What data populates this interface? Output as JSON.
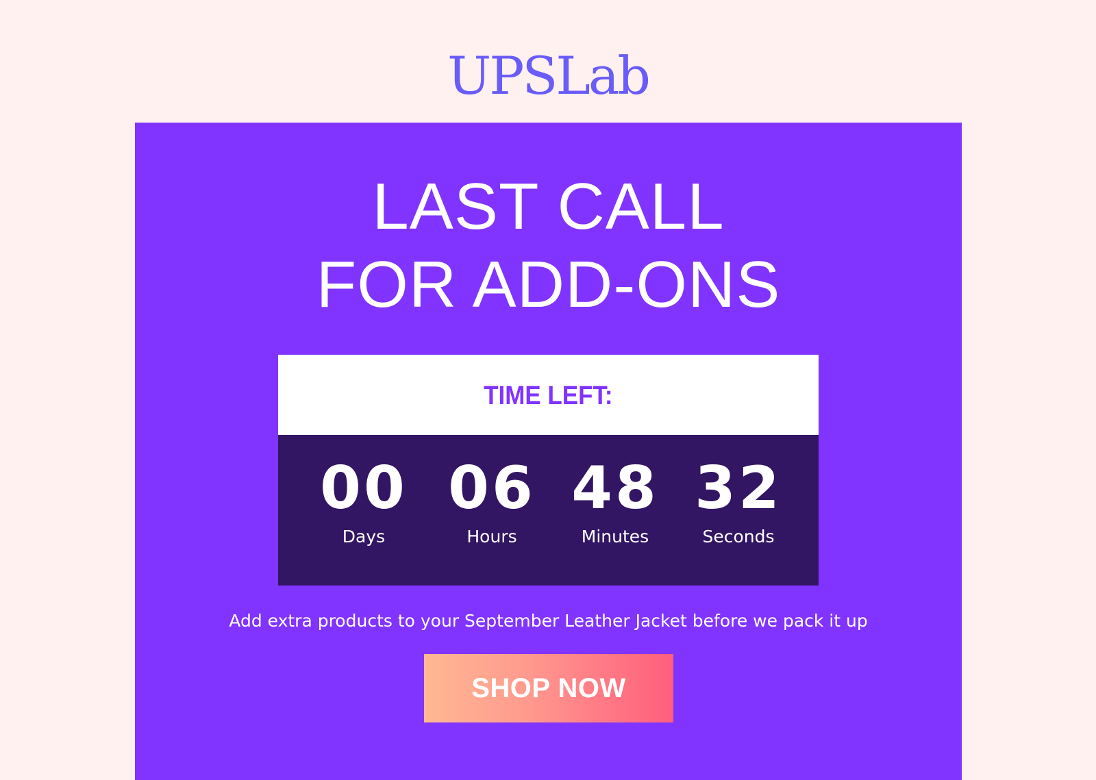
{
  "brand": {
    "logo_text": "UPSLab",
    "logo_color": "#6a5cf8"
  },
  "colors": {
    "page_background": "#fef1ef",
    "banner_background": "#8133ff",
    "timer_header_background": "#ffffff",
    "timer_body_background": "#321563",
    "cta_gradient_start": "#ffb893",
    "cta_gradient_end": "#ff5e7c"
  },
  "headline": {
    "line1": "LAST CALL",
    "line2": "FOR ADD-ONS"
  },
  "countdown": {
    "label": "TIME LEFT:",
    "units": [
      {
        "value": "00",
        "label": "Days"
      },
      {
        "value": "06",
        "label": "Hours"
      },
      {
        "value": "48",
        "label": "Minutes"
      },
      {
        "value": "32",
        "label": "Seconds"
      }
    ]
  },
  "subtitle": "Add extra products to your September Leather Jacket before we pack it up",
  "cta": {
    "label": "SHOP NOW"
  }
}
